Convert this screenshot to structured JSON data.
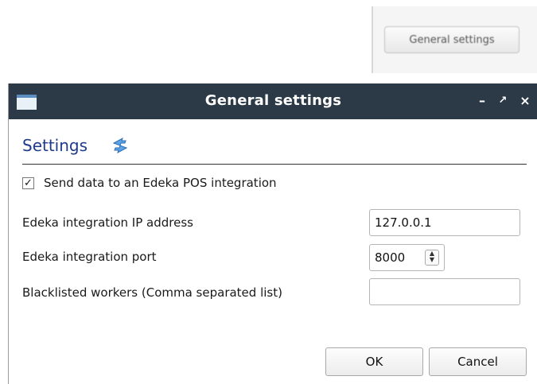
{
  "background": {
    "button_label": "General settings"
  },
  "dialog": {
    "title": "General settings",
    "controls": {
      "minimize": "–",
      "maximize": "↗",
      "close": "×"
    },
    "section_title": "Settings",
    "send_data": {
      "label": "Send data to an Edeka POS integration",
      "checked": true,
      "check_glyph": "✓"
    },
    "fields": {
      "ip_label": "Edeka integration IP address",
      "ip_value": "127.0.0.1",
      "port_label": "Edeka integration port",
      "port_value": "8000",
      "blacklist_label": "Blacklisted workers (Comma separated list)",
      "blacklist_value": ""
    },
    "buttons": {
      "ok": "OK",
      "cancel": "Cancel"
    },
    "colors": {
      "titlebar": "#2c3a47",
      "section_title": "#1e3a8a"
    },
    "icons": {
      "window": "window-icon",
      "refresh": "refresh-icon"
    }
  }
}
